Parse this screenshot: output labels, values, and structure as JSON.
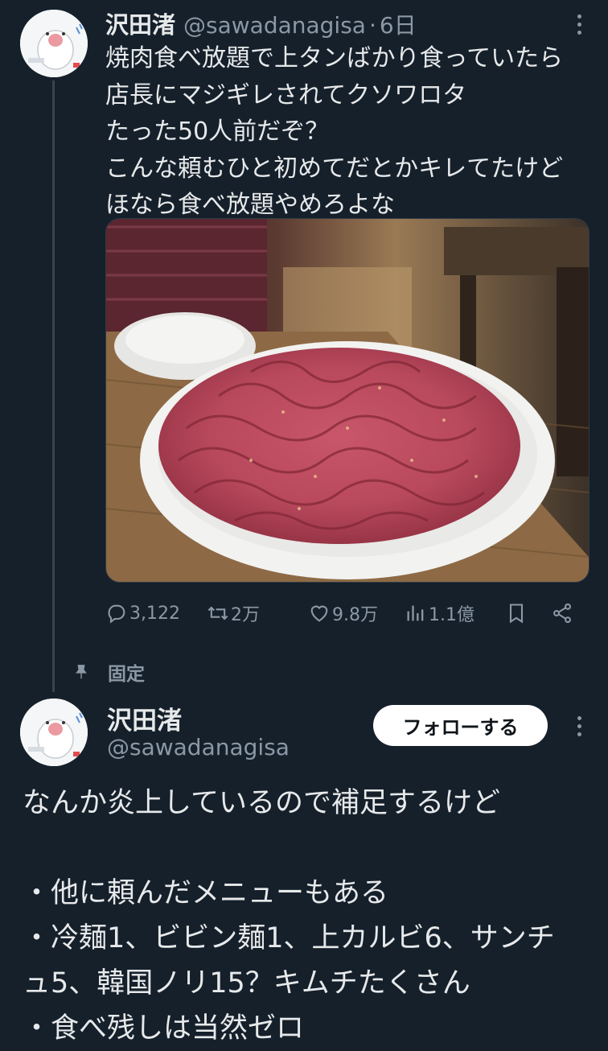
{
  "tweet": {
    "author_name": "沢田渚",
    "author_handle": "@sawadanagisa",
    "separator": "·",
    "time": "6日",
    "lines": [
      "焼肉食べ放題で上タンばかり食っていたら",
      "店長にマジギレされてクソワロタ",
      "たった50人前だぞ？",
      "こんな頼むひと初めてだとかキレてたけど",
      "ほなら食べ放題やめろよな"
    ],
    "media_icon": "photo-of-plate-of-raw-tongue-meat",
    "stats": {
      "replies": "3,122",
      "retweets": "2万",
      "likes": "9.8万",
      "views": "1.1億"
    },
    "icons": [
      "reply-icon",
      "retweet-icon",
      "like-icon",
      "views-icon",
      "bookmark-icon",
      "share-icon"
    ]
  },
  "pinned": {
    "label": "固定",
    "icon": "pin-icon"
  },
  "reply": {
    "author_name": "沢田渚",
    "author_handle": "@sawadanagisa",
    "follow_label": "フォローする",
    "lines": [
      "なんか炎上しているので補足するけど",
      "",
      "・他に頼んだメニューもある",
      "・冷麺1、ビビン麺1、上カルビ6、サンチ",
      "ュ5、韓国ノリ15？キムチたくさん",
      "・食べ残しは当然ゼロ"
    ]
  },
  "colors": {
    "background": "#15202b",
    "primary_text": "#e7e9ea",
    "secondary_text": "#8b98a5",
    "thread_line": "#38444d",
    "button_bg": "#ffffff"
  }
}
